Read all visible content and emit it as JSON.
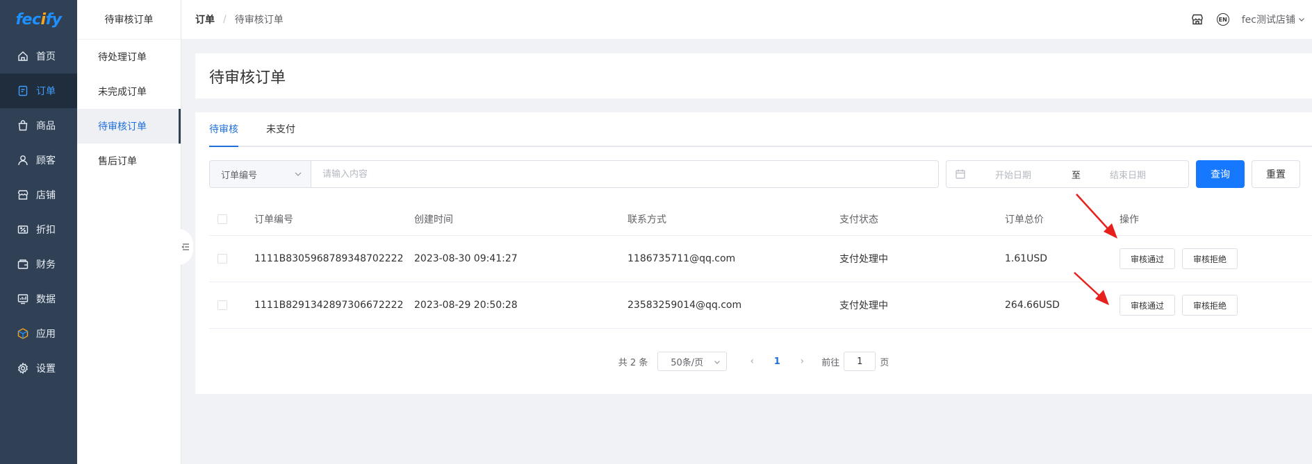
{
  "logo": {
    "text": "fecify"
  },
  "sidebar": {
    "items": [
      {
        "label": "首页",
        "icon": "home-icon"
      },
      {
        "label": "订单",
        "icon": "order-icon",
        "active": true
      },
      {
        "label": "商品",
        "icon": "bag-icon"
      },
      {
        "label": "顾客",
        "icon": "user-icon"
      },
      {
        "label": "店铺",
        "icon": "store-icon"
      },
      {
        "label": "折扣",
        "icon": "discount-icon"
      },
      {
        "label": "财务",
        "icon": "wallet-icon"
      },
      {
        "label": "数据",
        "icon": "chart-icon"
      },
      {
        "label": "应用",
        "icon": "app-cube-icon"
      },
      {
        "label": "设置",
        "icon": "gear-icon"
      }
    ]
  },
  "submenu": {
    "title": "待审核订单",
    "items": [
      {
        "label": "待处理订单"
      },
      {
        "label": "未完成订单"
      },
      {
        "label": "待审核订单",
        "active": true
      },
      {
        "label": "售后订单"
      }
    ]
  },
  "header": {
    "breadcrumb": [
      "订单",
      "待审核订单"
    ],
    "separator": "/",
    "lang_badge": "EN",
    "store_name": "fec测试店铺"
  },
  "page": {
    "title": "待审核订单"
  },
  "tabs": [
    {
      "label": "待审核",
      "active": true
    },
    {
      "label": "未支付"
    }
  ],
  "filter": {
    "field_select": "订单编号",
    "search_placeholder": "请输入内容",
    "date_start_placeholder": "开始日期",
    "date_separator": "至",
    "date_end_placeholder": "结束日期",
    "query_button": "查询",
    "reset_button": "重置"
  },
  "table": {
    "columns": [
      "订单编号",
      "创建时间",
      "联系方式",
      "支付状态",
      "订单总价",
      "操作"
    ],
    "rows": [
      {
        "order_no": "1111B8305968789348702222",
        "created": "2023-08-30 09:41:27",
        "contact": "1186735711@qq.com",
        "pay_status": "支付处理中",
        "total": "1.61USD"
      },
      {
        "order_no": "1111B8291342897306672222",
        "created": "2023-08-29 20:50:28",
        "contact": "23583259014@qq.com",
        "pay_status": "支付处理中",
        "total": "264.66USD"
      }
    ],
    "approve_label": "审核通过",
    "reject_label": "审核拒绝"
  },
  "pagination": {
    "total_text": "共 2 条",
    "page_size": "50条/页",
    "current_page": "1",
    "goto_prefix": "前往",
    "goto_value": "1",
    "goto_suffix": "页"
  },
  "colors": {
    "primary": "#1677ff",
    "sidebar_bg": "#304156",
    "annotation_arrow": "#e8201c"
  }
}
